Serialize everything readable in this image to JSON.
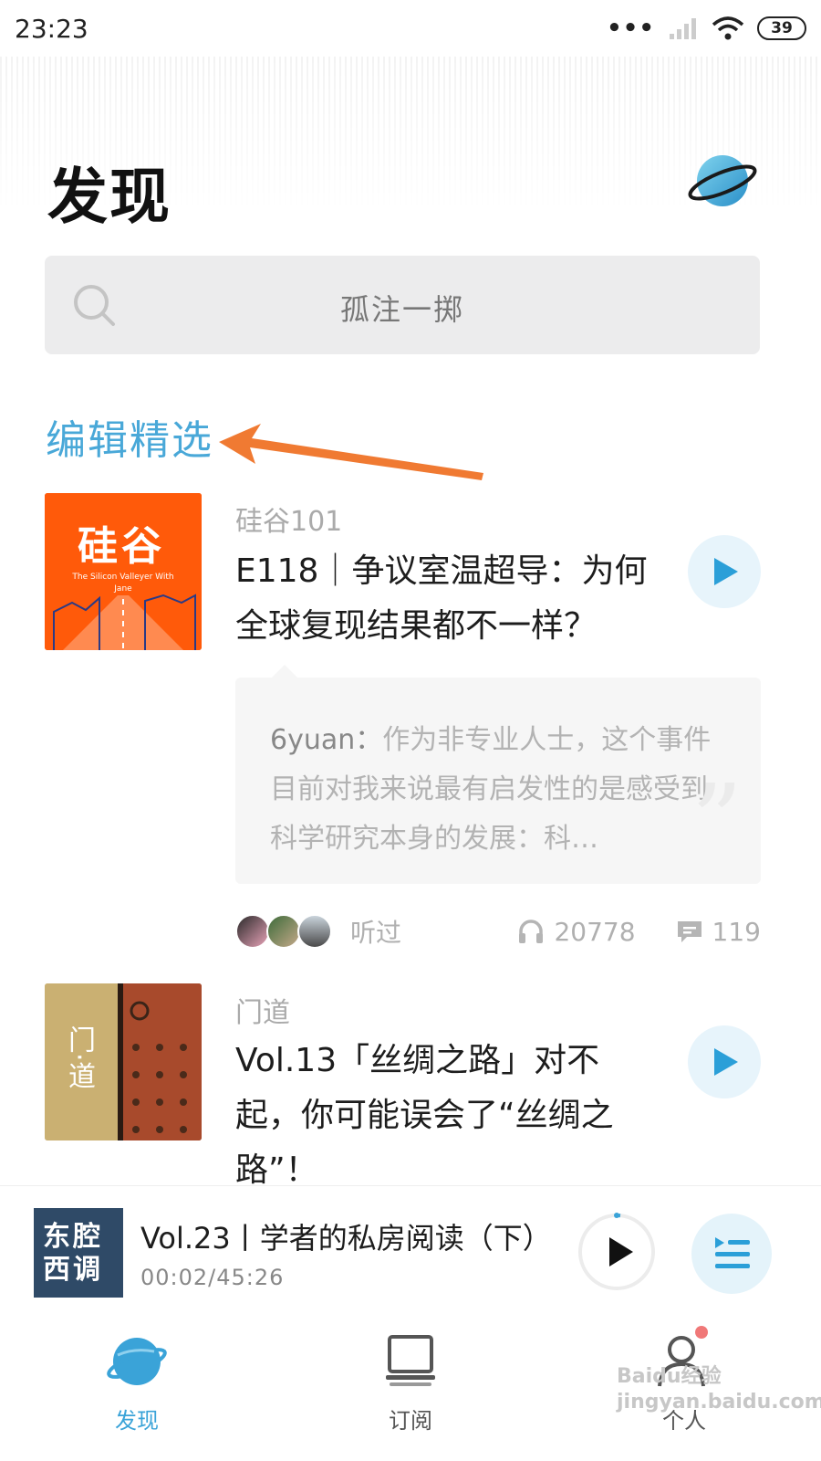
{
  "status_bar": {
    "time": "23:23",
    "battery": "39"
  },
  "header": {
    "title": "发现"
  },
  "search": {
    "placeholder": "孤注一掷"
  },
  "section": {
    "title": "编辑精选"
  },
  "episodes": [
    {
      "podcast": "硅谷101",
      "title": "E118｜争议室温超导：为何全球复现结果都不一样？",
      "cover_title": "硅谷",
      "cover_subtitle": "The Silicon Valleyer With Jane",
      "comment_user": "6yuan：",
      "comment_text": "作为非专业人士，这个事件目前对我来说最有启发性的是感受到科学研究本身的发展：科…",
      "heard_label": "听过",
      "listens": "20778",
      "comments": "119"
    },
    {
      "podcast": "门道",
      "title": "Vol.13「丝绸之路」对不起，你可能误会了“丝绸之路”！",
      "cover_title": "门·道"
    }
  ],
  "player": {
    "cover_text_1": "东腔",
    "cover_text_2": "西调",
    "title": "Vol.23丨学者的私房阅读（下）",
    "time": "00:02/45:26"
  },
  "tabs": [
    {
      "label": "发现",
      "active": true
    },
    {
      "label": "订阅",
      "active": false
    },
    {
      "label": "个人",
      "active": false
    }
  ],
  "colors": {
    "accent": "#3aa3d8",
    "annotation_arrow": "#f07a32",
    "cover_orange": "#ff5a0a",
    "player_cover": "#2f4a67"
  },
  "watermark": "Baidu经验 jingyan.baidu.com"
}
